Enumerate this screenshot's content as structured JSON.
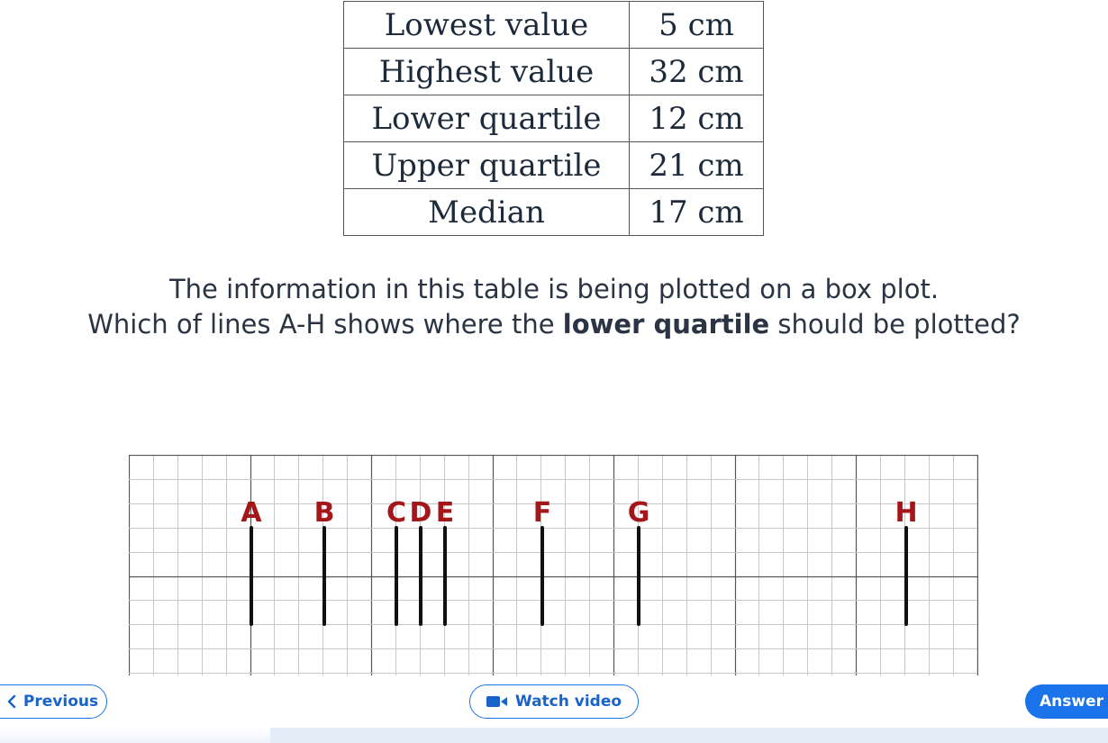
{
  "table": {
    "rows": [
      {
        "label": "Lowest value",
        "value": "5 cm"
      },
      {
        "label": "Highest value",
        "value": "32 cm"
      },
      {
        "label": "Lower quartile",
        "value": "12 cm"
      },
      {
        "label": "Upper quartile",
        "value": "21 cm"
      },
      {
        "label": "Median",
        "value": "17 cm"
      }
    ]
  },
  "question": {
    "line1": "The information in this table is being plotted on a box plot.",
    "line2_prefix": "Which of lines A-H shows where the ",
    "line2_bold": "lower quartile",
    "line2_suffix": " should be plotted?"
  },
  "grid": {
    "lines": [
      {
        "label": "A"
      },
      {
        "label": "B"
      },
      {
        "label": "C"
      },
      {
        "label": "D"
      },
      {
        "label": "E"
      },
      {
        "label": "F"
      },
      {
        "label": "G"
      },
      {
        "label": "H"
      }
    ]
  },
  "colors": {
    "label_red": "#a4161a",
    "primary_blue": "#1a73e8"
  },
  "footer": {
    "previous_label": "Previous",
    "previous_icon": "chevron-left-icon",
    "video_label": "Watch video",
    "video_icon": "video-camera-icon",
    "answer_label": "Answer"
  }
}
